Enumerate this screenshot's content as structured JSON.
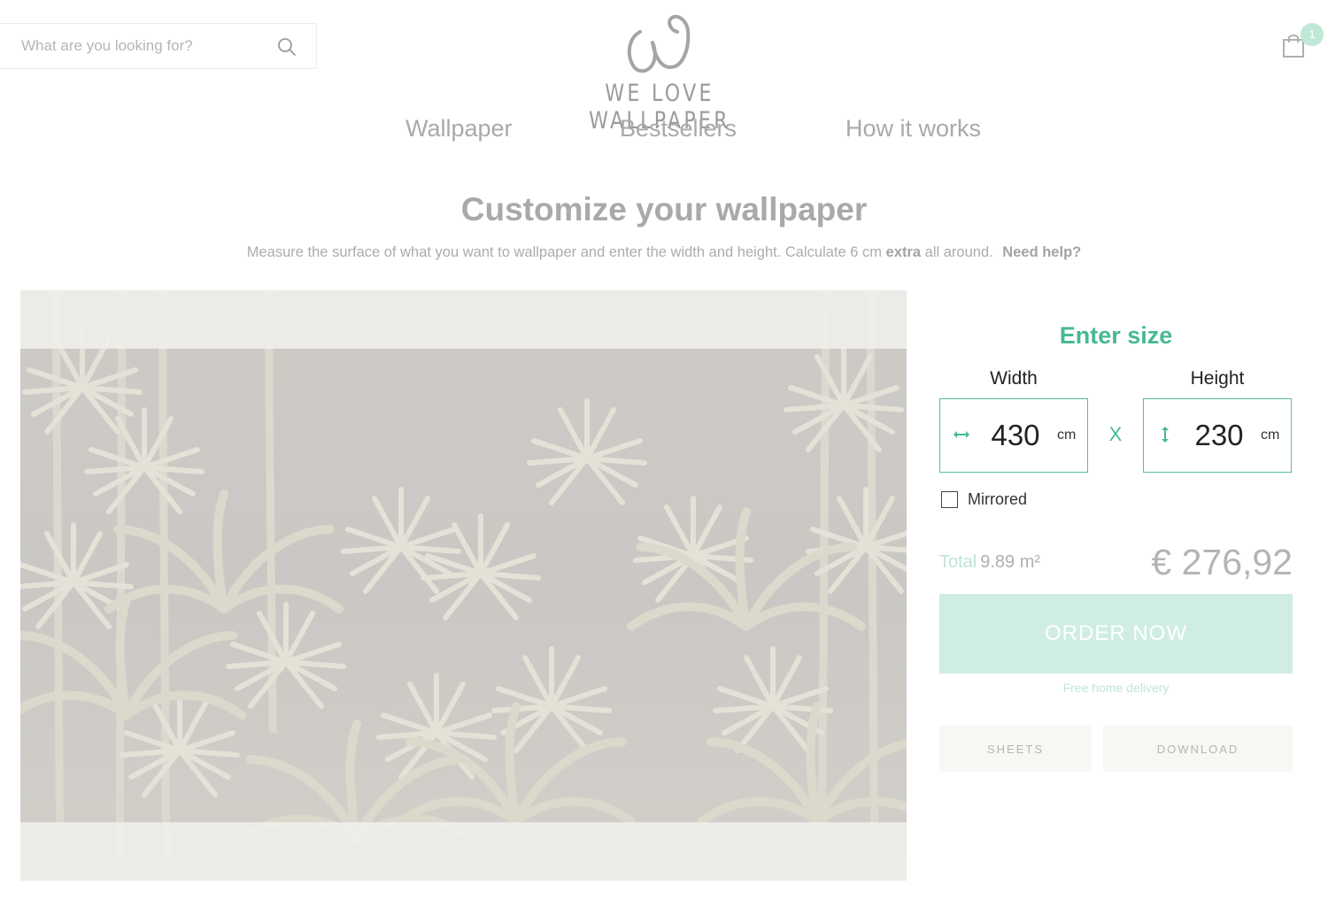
{
  "search": {
    "placeholder": "What are you looking for?"
  },
  "logo": {
    "text": "WE LOVE WALLPAPER"
  },
  "cart": {
    "count": "1"
  },
  "nav": {
    "items": [
      {
        "label": "Wallpaper"
      },
      {
        "label": "Bestsellers"
      },
      {
        "label": "How it works"
      }
    ]
  },
  "main": {
    "title": "Customize your wallpaper",
    "subtitle_part1": "Measure the surface of what you want to wallpaper and enter the width and height. Calculate 6 cm ",
    "subtitle_bold": "extra",
    "subtitle_part2": " all around.",
    "help_link": "Need help?"
  },
  "configurator": {
    "heading": "Enter size",
    "width": {
      "label": "Width",
      "value": "430",
      "unit": "cm"
    },
    "height": {
      "label": "Height",
      "value": "230",
      "unit": "cm"
    },
    "times": "X",
    "mirrored_label": "Mirrored",
    "mirrored": false,
    "total_label": "Total",
    "total_area": "9.89 m²",
    "price": "€ 276,92",
    "order_label": "ORDER NOW",
    "delivery_note": "Free home delivery",
    "sheets_label": "SHEETS",
    "download_label": "DOWNLOAD"
  },
  "colors": {
    "accent": "#47b990",
    "order_bg": "#cfeee1",
    "badge_bg": "#bfe8d6"
  },
  "icons": {
    "search": "search-icon",
    "cart": "shopping-bag-icon",
    "width_arrow": "horizontal-arrow-icon",
    "height_arrow": "vertical-arrow-icon"
  }
}
